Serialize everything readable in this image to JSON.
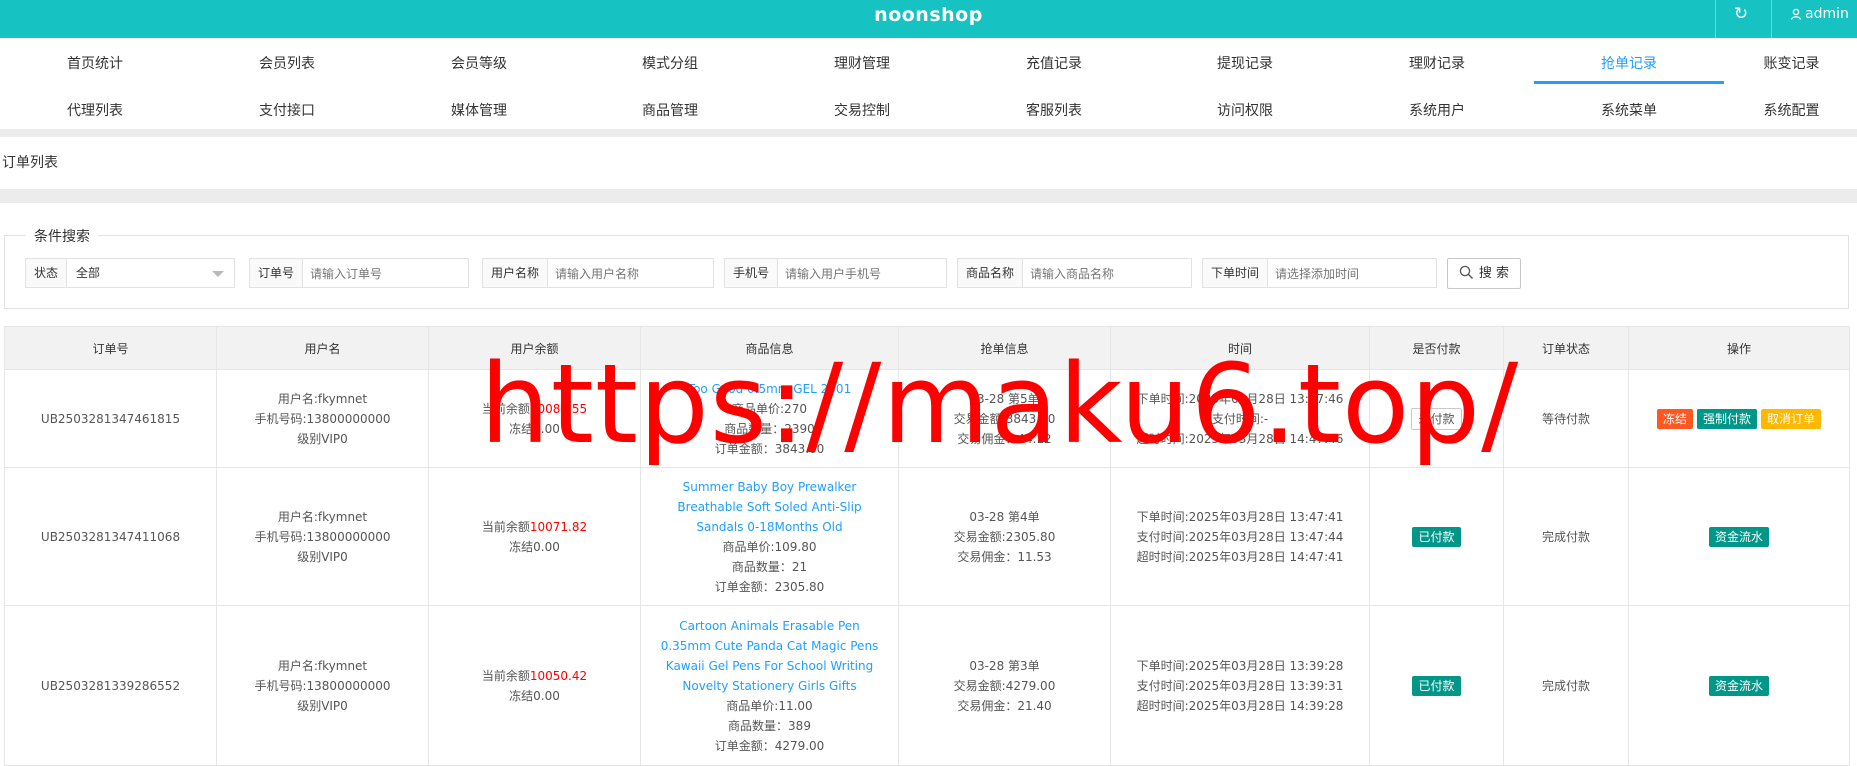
{
  "header": {
    "title": "noonshop",
    "user": "admin"
  },
  "nav": [
    {
      "label": "首页统计"
    },
    {
      "label": "会员列表"
    },
    {
      "label": "会员等级"
    },
    {
      "label": "模式分组"
    },
    {
      "label": "理财管理"
    },
    {
      "label": "充值记录"
    },
    {
      "label": "提现记录"
    },
    {
      "label": "理财记录"
    },
    {
      "label": "抢单记录",
      "active": true
    },
    {
      "label": "账变记录"
    },
    {
      "label": "代理列表"
    },
    {
      "label": "支付接口"
    },
    {
      "label": "媒体管理"
    },
    {
      "label": "商品管理"
    },
    {
      "label": "交易控制"
    },
    {
      "label": "客服列表"
    },
    {
      "label": "访问权限"
    },
    {
      "label": "系统用户"
    },
    {
      "label": "系统菜单"
    },
    {
      "label": "系统配置"
    }
  ],
  "breadcrumb": "订单列表",
  "search": {
    "legend": "条件搜索",
    "status_label": "状态",
    "status_value": "全部",
    "order_label": "订单号",
    "order_placeholder": "请输入订单号",
    "username_label": "用户名称",
    "username_placeholder": "请输入用户名称",
    "phone_label": "手机号",
    "phone_placeholder": "请输入用户手机号",
    "product_label": "商品名称",
    "product_placeholder": "请输入商品名称",
    "time_label": "下单时间",
    "time_placeholder": "请选择添加时间",
    "button": "搜 索"
  },
  "table": {
    "headers": [
      "订单号",
      "用户名",
      "用户余额",
      "商品信息",
      "抢单信息",
      "时间",
      "是否付款",
      "订单状态",
      "操作"
    ],
    "rows": [
      {
        "order_id": "UB2503281347461815",
        "user_name": "用户名:fkymnet",
        "user_phone": "手机号码:13800000000",
        "user_level": "级别VIP0",
        "balance_label": "当前余额",
        "balance": "10083.55",
        "frozen": "冻结0.00",
        "product_name": "Too Good 0.5mm GEL 2501",
        "unit_price": "商品单价:270",
        "quantity": "商品数量：2390",
        "amount": "订单金额：3843.00",
        "grab_round": "03-28 第5单",
        "grab_amount": "交易金额:3843.00",
        "grab_commission": "交易佣金：44.12",
        "time_order": "下单时间:2025年03月28日 13:47:46",
        "time_pay": "支付时间:-",
        "time_timeout": "超时时间:2025年03月28日 14:47:46",
        "paid": "未付款",
        "paid_style": "outline",
        "status": "等待付款",
        "actions": [
          {
            "label": "冻结",
            "style": "orange"
          },
          {
            "label": "强制付款",
            "style": "teal"
          },
          {
            "label": "取消订单",
            "style": "yellow"
          }
        ]
      },
      {
        "order_id": "UB2503281347411068",
        "user_name": "用户名:fkymnet",
        "user_phone": "手机号码:13800000000",
        "user_level": "级别VIP0",
        "balance_label": "当前余额",
        "balance": "10071.82",
        "frozen": "冻结0.00",
        "product_name": "Summer Baby Boy Prewalker Breathable Soft Soled Anti-Slip Sandals 0-18Months Old",
        "unit_price": "商品单价:109.80",
        "quantity": "商品数量：21",
        "amount": "订单金额：2305.80",
        "grab_round": "03-28 第4单",
        "grab_amount": "交易金额:2305.80",
        "grab_commission": "交易佣金：11.53",
        "time_order": "下单时间:2025年03月28日 13:47:41",
        "time_pay": "支付时间:2025年03月28日 13:47:44",
        "time_timeout": "超时时间:2025年03月28日 14:47:41",
        "paid": "已付款",
        "paid_style": "teal",
        "status": "完成付款",
        "actions": [
          {
            "label": "资金流水",
            "style": "teal"
          }
        ]
      },
      {
        "order_id": "UB2503281339286552",
        "user_name": "用户名:fkymnet",
        "user_phone": "手机号码:13800000000",
        "user_level": "级别VIP0",
        "balance_label": "当前余额",
        "balance": "10050.42",
        "frozen": "冻结0.00",
        "product_name": "Cartoon Animals Erasable Pen 0.35mm Cute Panda Cat Magic Pens Kawaii Gel Pens For School Writing Novelty Stationery Girls Gifts",
        "unit_price": "商品单价:11.00",
        "quantity": "商品数量：389",
        "amount": "订单金额：4279.00",
        "grab_round": "03-28 第3单",
        "grab_amount": "交易金额:4279.00",
        "grab_commission": "交易佣金：21.40",
        "time_order": "下单时间:2025年03月28日 13:39:28",
        "time_pay": "支付时间:2025年03月28日 13:39:31",
        "time_timeout": "超时时间:2025年03月28日 14:39:28",
        "paid": "已付款",
        "paid_style": "teal",
        "status": "完成付款",
        "actions": [
          {
            "label": "资金流水",
            "style": "teal"
          }
        ]
      }
    ]
  },
  "watermark": "https://maku6.top/"
}
